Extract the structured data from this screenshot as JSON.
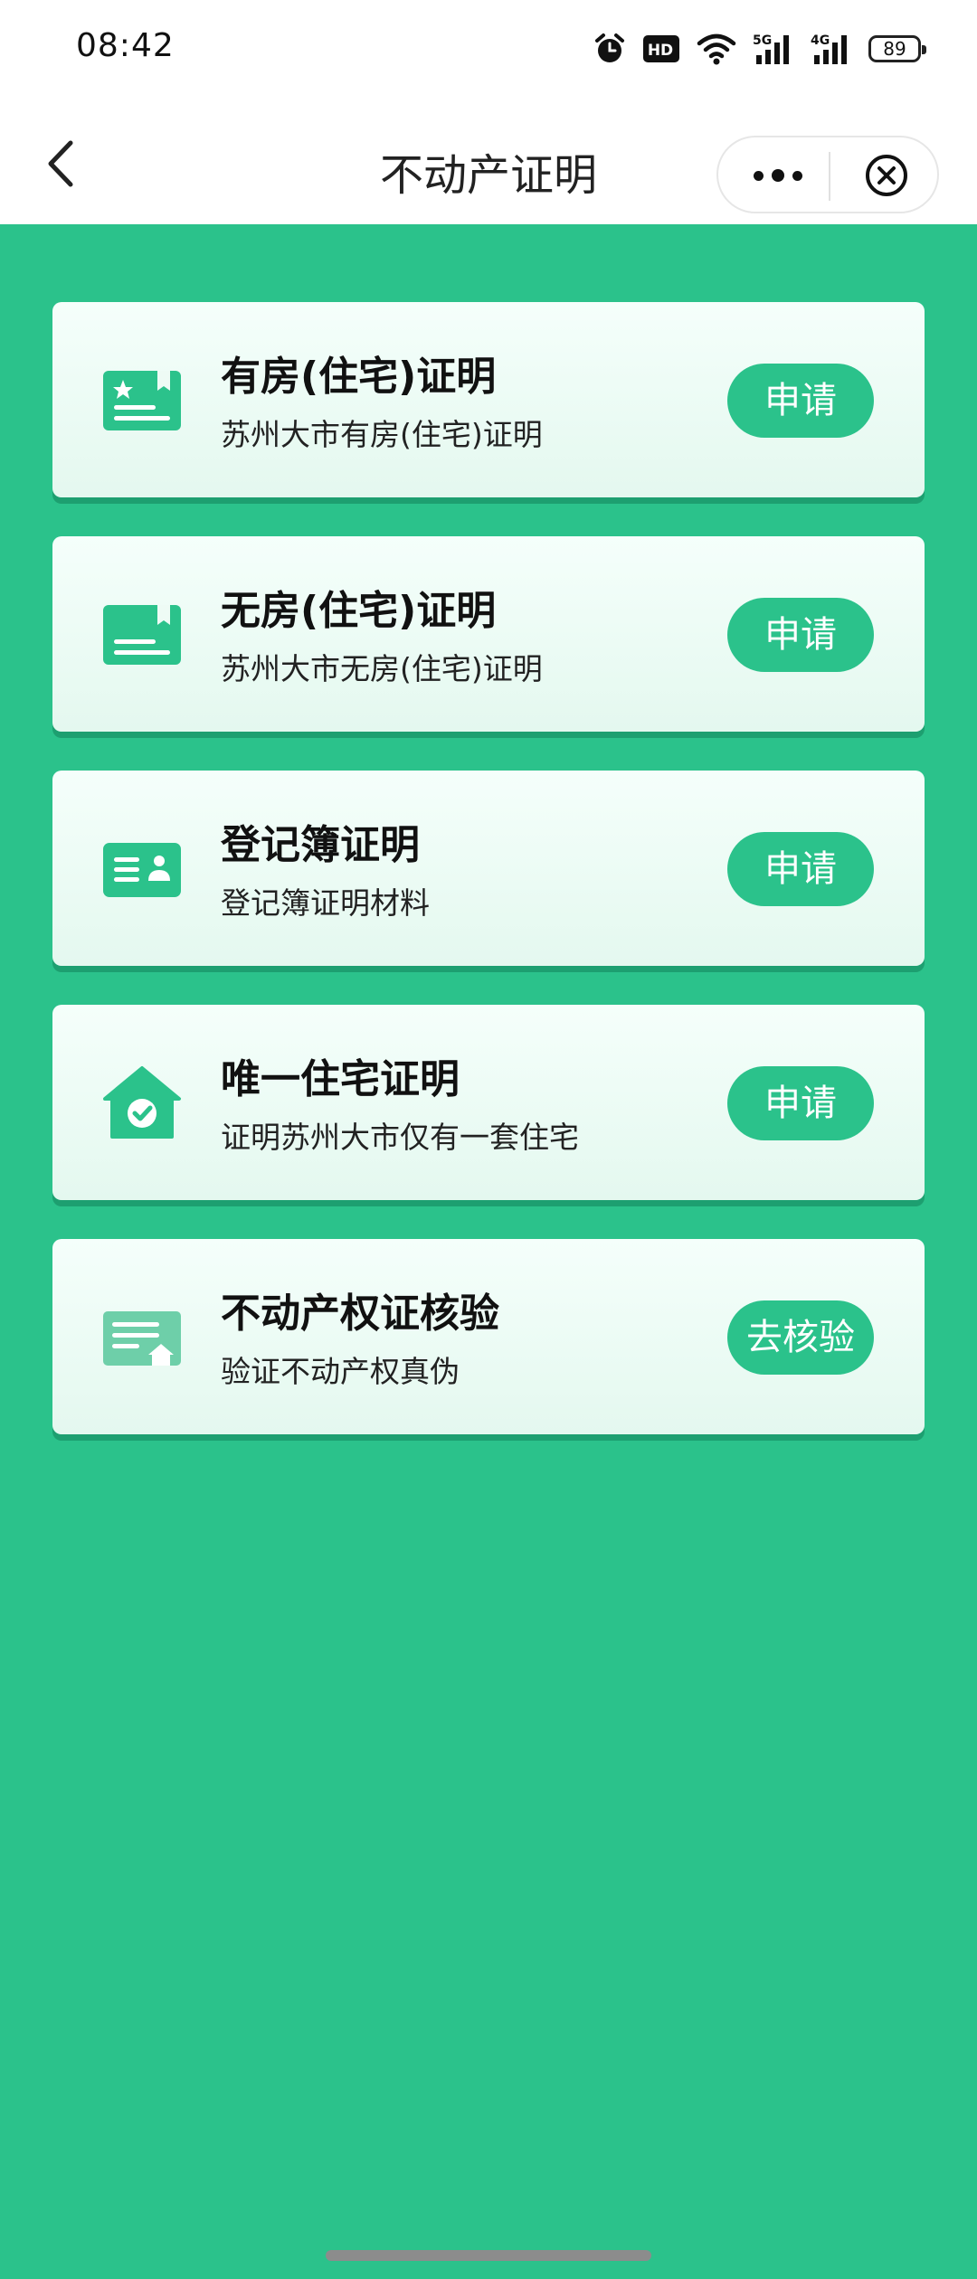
{
  "status_bar": {
    "time": "08:42",
    "hd_label": "HD",
    "signal1_label": "5G",
    "signal2_label": "4G",
    "battery": "89",
    "icons": [
      "alarm-icon",
      "hd-icon",
      "wifi-icon",
      "5g-signal-icon",
      "4g-signal-icon",
      "battery-icon"
    ]
  },
  "nav": {
    "title": "不动产证明",
    "back_icon": "chevron-left-icon",
    "more_icon": "more-dots-icon",
    "close_icon": "close-circle-icon"
  },
  "colors": {
    "background": "#2bc28b",
    "button": "#2bc28b",
    "card": "#eefbf5"
  },
  "cards": [
    {
      "title": "有房(住宅)证明",
      "subtitle": "苏州大市有房(住宅)证明",
      "button": "申请",
      "icon": "certificate-star-icon"
    },
    {
      "title": "无房(住宅)证明",
      "subtitle": "苏州大市无房(住宅)证明",
      "button": "申请",
      "icon": "certificate-bookmark-icon"
    },
    {
      "title": "登记簿证明",
      "subtitle": "登记簿证明材料",
      "button": "申请",
      "icon": "id-card-icon"
    },
    {
      "title": "唯一住宅证明",
      "subtitle": "证明苏州大市仅有一套住宅",
      "button": "申请",
      "icon": "house-check-icon"
    },
    {
      "title": "不动产权证核验",
      "subtitle": "验证不动产权真伪",
      "button": "去核验",
      "icon": "document-house-icon"
    }
  ]
}
